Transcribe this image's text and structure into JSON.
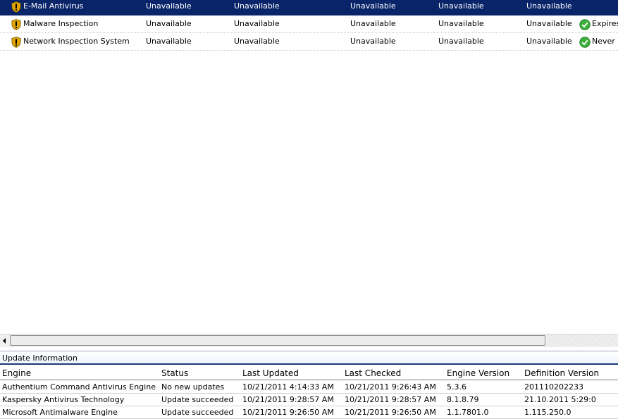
{
  "protection_rows": [
    {
      "name": "E-Mail Antivirus",
      "c1": "Unavailable",
      "c2": "Unavailable",
      "c3": "Unavailable",
      "c4": "Unavailable",
      "c5": "Unavailable",
      "license": ""
    },
    {
      "name": "Malware Inspection",
      "c1": "Unavailable",
      "c2": "Unavailable",
      "c3": "Unavailable",
      "c4": "Unavailable",
      "c5": "Unavailable",
      "license": "Expires"
    },
    {
      "name": "Network Inspection System",
      "c1": "Unavailable",
      "c2": "Unavailable",
      "c3": "Unavailable",
      "c4": "Unavailable",
      "c5": "Unavailable",
      "license": "Never E"
    }
  ],
  "update_panel": {
    "title": "Update Information",
    "headers": {
      "engine": "Engine",
      "status": "Status",
      "last_updated": "Last Updated",
      "last_checked": "Last Checked",
      "engine_version": "Engine Version",
      "definition_version": "Definition Version"
    },
    "rows": [
      {
        "engine": "Authentium Command Antivirus Engine",
        "status": "No new updates",
        "last_updated": "10/21/2011 4:14:33 AM",
        "last_checked": "10/21/2011 9:26:43 AM",
        "engine_version": "5.3.6",
        "definition_version": "201110202233"
      },
      {
        "engine": "Kaspersky Antivirus Technology",
        "status": "Update succeeded",
        "last_updated": "10/21/2011 9:28:57 AM",
        "last_checked": "10/21/2011 9:28:57 AM",
        "engine_version": "8.1.8.79",
        "definition_version": "21.10.2011 5:29:0"
      },
      {
        "engine": "Microsoft Antimalware Engine",
        "status": "Update succeeded",
        "last_updated": "10/21/2011 9:26:50 AM",
        "last_checked": "10/21/2011 9:26:50 AM",
        "engine_version": "1.1.7801.0",
        "definition_version": "1.115.250.0"
      }
    ]
  },
  "icons": {
    "row_icon": "warning-shield-icon",
    "license_icon": "green-check-icon",
    "scroll_left": "scroll-left-arrow-icon"
  },
  "colors": {
    "selection": "#0a246a",
    "panel_accent": "#1f3a7a",
    "check_green": "#3cae3c",
    "shield_gold": "#e0a500"
  }
}
